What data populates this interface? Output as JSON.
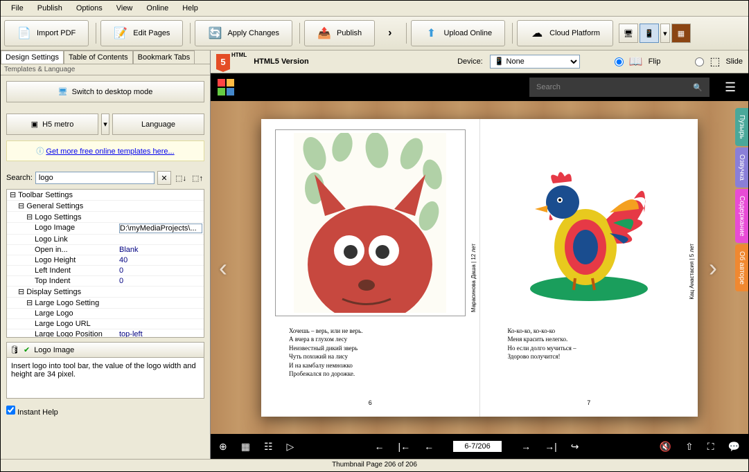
{
  "menu": {
    "file": "File",
    "publish": "Publish",
    "options": "Options",
    "view": "View",
    "online": "Online",
    "help": "Help"
  },
  "toolbar": {
    "import": "Import PDF",
    "edit": "Edit Pages",
    "apply": "Apply Changes",
    "publish": "Publish",
    "upload": "Upload Online",
    "cloud": "Cloud Platform"
  },
  "leftTabs": {
    "design": "Design Settings",
    "toc": "Table of Contents",
    "bookmark": "Bookmark Tabs"
  },
  "sectionLabel": "Templates & Language",
  "buttons": {
    "desktop": "Switch to desktop mode",
    "theme": "H5 metro",
    "language": "Language"
  },
  "templateLink": "Get more free online templates here...",
  "search": {
    "label": "Search:",
    "value": "logo"
  },
  "tree": [
    {
      "label": "Toolbar Settings",
      "indent": 0,
      "expand": "⊟"
    },
    {
      "label": "General Settings",
      "indent": 1,
      "expand": "⊟"
    },
    {
      "label": "Logo Settings",
      "indent": 2,
      "expand": "⊟"
    },
    {
      "label": "Logo Image",
      "value": "D:\\myMediaProjects\\...",
      "indent": 3,
      "selected": true
    },
    {
      "label": "Logo Link",
      "value": "",
      "indent": 3
    },
    {
      "label": "Open in...",
      "value": "Blank",
      "indent": 3
    },
    {
      "label": "Logo Height",
      "value": "40",
      "indent": 3
    },
    {
      "label": "Left Indent",
      "value": "0",
      "indent": 3
    },
    {
      "label": "Top Indent",
      "value": "0",
      "indent": 3
    },
    {
      "label": "Display Settings",
      "indent": 1,
      "expand": "⊟"
    },
    {
      "label": "Large Logo Setting",
      "indent": 2,
      "expand": "⊟"
    },
    {
      "label": "Large Logo",
      "value": "",
      "indent": 3
    },
    {
      "label": "Large Logo URL",
      "value": "",
      "indent": 3
    },
    {
      "label": "Large Logo Position",
      "value": "top-left",
      "indent": 3
    }
  ],
  "help": {
    "title": "Logo Image",
    "text": "Insert logo into tool bar, the value of the logo width and height are 34 pixel.",
    "instant": "Instant Help"
  },
  "preview": {
    "html5": "HTML5 Version",
    "device": "Device:",
    "none": "None",
    "flip": "Flip",
    "slide": "Slide",
    "search": "Search"
  },
  "bookTabs": [
    {
      "label": "Пузырь",
      "color": "#4aa89a"
    },
    {
      "label": "Озвучка",
      "color": "#8a7fd8"
    },
    {
      "label": "Содержание",
      "color": "#e84cd6"
    },
    {
      "label": "Об авторе",
      "color": "#f08830"
    }
  ],
  "pages": {
    "leftPoem": "Хочешь – верь, или не верь.\nА вчера в глухом лесу\nНеизвестный дикий зверь\nЧуть похожий на лису\nИ на камбалу немножко\nПробежался по дорожке.",
    "rightPoem": "Ко-ко-ко, ко-ко-ко\nМеня красить нелегко.\nНо если долго мучиться –\nЗдорово получится!",
    "leftSide": "Марасинова Даша | 12 лет",
    "rightSide": "Кац Анастасия | 5 лет",
    "leftNum": "6",
    "rightNum": "7",
    "counter": "6-7/206"
  },
  "status": "Thumbnail Page 206 of 206"
}
